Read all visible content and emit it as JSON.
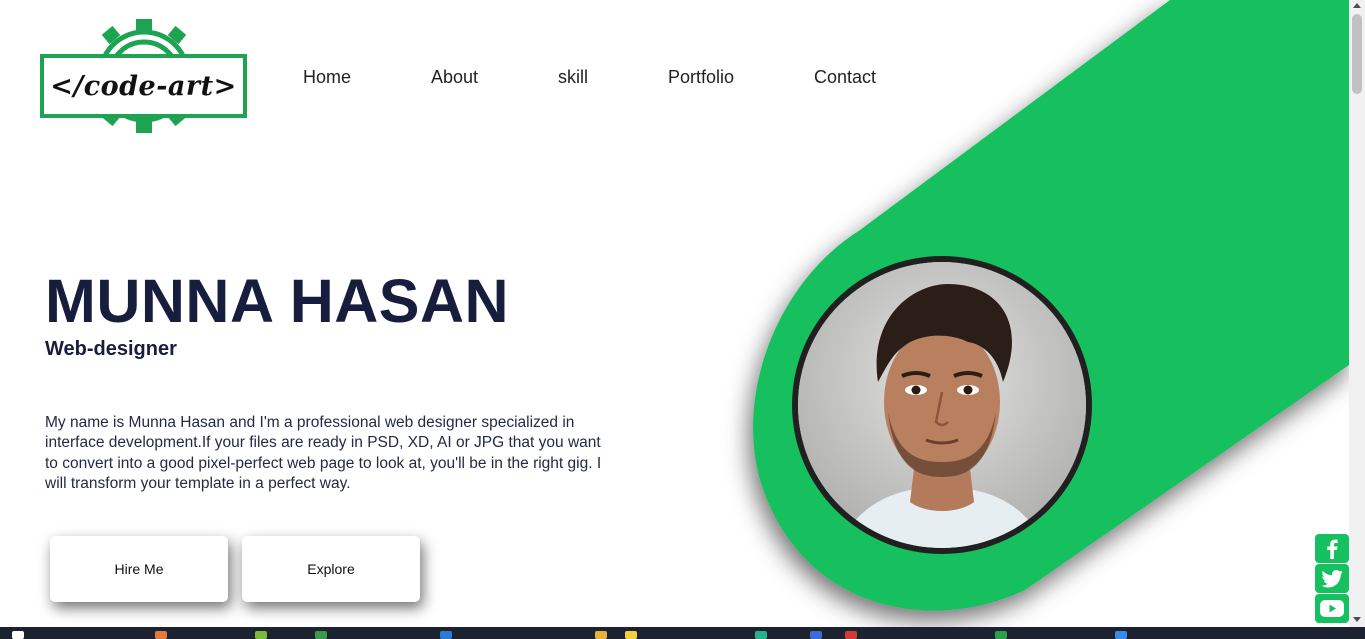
{
  "logo": {
    "text": "</code-art>",
    "brand_color": "#1ea352"
  },
  "nav": {
    "items": [
      "Home",
      "About",
      "skill",
      "Portfolio",
      "Contact"
    ]
  },
  "hero": {
    "name": "MUNNA HASAN",
    "role": "Web-designer",
    "description": "My name is Munna Hasan and I'm a professional web designer specialized in interface development.If your files are ready in PSD, XD, AI or JPG that you want to convert into a good pixel-perfect web page to look at, you'll be in the right gig. I will transform your template in a perfect way.",
    "buttons": {
      "hire": "Hire Me",
      "explore": "Explore"
    }
  },
  "colors": {
    "accent_green": "#14c05f",
    "heading": "#161d3d"
  },
  "social": {
    "icons": [
      "facebook-icon",
      "twitter-icon",
      "youtube-icon"
    ]
  }
}
